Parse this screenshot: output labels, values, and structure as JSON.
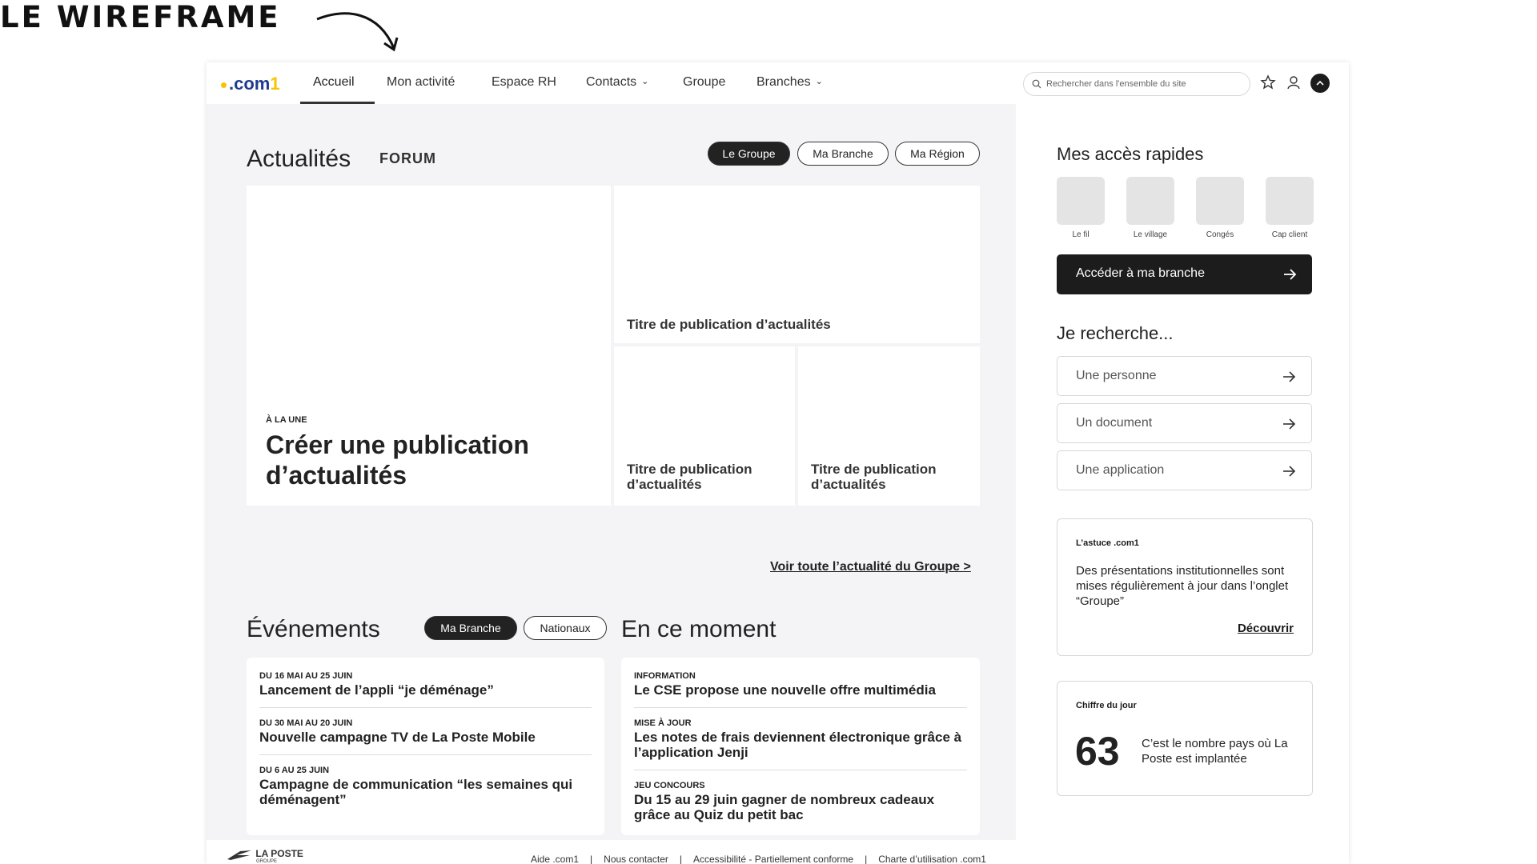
{
  "slide_title": "LE WIREFRAME",
  "nav": {
    "logo": {
      "text": ".com",
      "one": "1"
    },
    "items": [
      "Accueil",
      "Mon activité",
      "Espace RH",
      "Contacts",
      "Groupe",
      "Branches"
    ],
    "search_placeholder": "Rechercher dans l'ensemble du site",
    "icons": [
      "star-icon",
      "user-icon",
      "chevron-up-icon"
    ]
  },
  "actualites": {
    "heading": "Actualités",
    "forum": "FORUM",
    "filters": [
      "Le Groupe",
      "Ma Branche",
      "Ma Région"
    ],
    "featured": {
      "kicker": "À LA UNE",
      "title": "Créer une publication d’actualités"
    },
    "cards": [
      "Titre de publication d’actualités",
      "Titre de publication d’actualités",
      "Titre de publication d’actualités"
    ],
    "see_all": "Voir toute l’actualité du Groupe >"
  },
  "evenements": {
    "heading": "Événements",
    "filters": [
      "Ma Branche",
      "Nationaux"
    ],
    "items": [
      {
        "date": "DU 16 MAI AU 25 JUIN",
        "title": "Lancement de l’appli “je déménage”"
      },
      {
        "date": "DU 30 MAI AU 20 JUIN",
        "title": "Nouvelle campagne TV de La Poste Mobile"
      },
      {
        "date": "DU 6 AU 25 JUIN",
        "title": "Campagne de communication “les semaines qui déménagent”"
      }
    ]
  },
  "en_ce_moment": {
    "heading": "En ce moment",
    "items": [
      {
        "tag": "INFORMATION",
        "title": "Le CSE propose une nouvelle offre multimédia"
      },
      {
        "tag": "MISE À JOUR",
        "title": "Les notes de frais deviennent électronique grâce à l’application Jenji"
      },
      {
        "tag": "JEU CONCOURS",
        "title": "Du 15 au 29 juin gagner de nombreux cadeaux grâce au Quiz du petit bac"
      }
    ]
  },
  "acces_rapides": {
    "heading": "Mes accès rapides",
    "tiles": [
      "Le fil",
      "Le village",
      "Congés",
      "Cap client"
    ],
    "cta": "Accéder à ma branche"
  },
  "je_recherche": {
    "heading": "Je recherche...",
    "options": [
      "Une personne",
      "Un document",
      "Une application"
    ]
  },
  "astuce": {
    "label": "L’astuce .com1",
    "text": "Des présentations institutionnelles sont mises régulièrement à jour dans l’onglet “Groupe”",
    "link": "Découvrir"
  },
  "chiffre": {
    "label": "Chiffre du jour",
    "number": "63",
    "text": "C’est le nombre pays où La Poste est implantée"
  },
  "footer": {
    "logo_text": "LA POSTE",
    "logo_sub": "GROUPE",
    "links": [
      "Aide .com1",
      "Nous contacter",
      "Accessibilité - Partiellement conforme",
      "Charte d’utilisation .com1"
    ]
  },
  "colors": {
    "dark": "#1c1c1c",
    "panel_bg": "#f4f4f6",
    "logo_blue": "#1f3b8f",
    "logo_yellow": "#f7c400"
  }
}
